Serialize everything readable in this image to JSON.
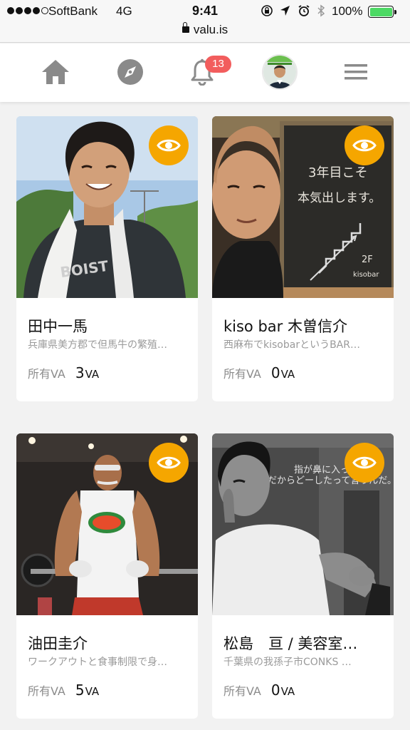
{
  "status_bar": {
    "carrier": "SoftBank",
    "network": "4G",
    "time": "9:41",
    "battery": "100%",
    "battery_level": 1.0,
    "signal_bars_filled": 4,
    "signal_bars_total": 5,
    "icons": [
      "rotation-lock-icon",
      "location-arrow-icon",
      "alarm-icon",
      "bluetooth-icon"
    ]
  },
  "url_bar": {
    "domain": "valu.is",
    "secure": true
  },
  "nav": {
    "items": [
      "home-icon",
      "compass-icon",
      "bell-icon",
      "avatar",
      "menu-icon"
    ],
    "notification_count": "13"
  },
  "colors": {
    "accent": "#f5a600",
    "badge": "#f25d5d",
    "background": "#f2f2f2",
    "battery": "#4cd964"
  },
  "cards": [
    {
      "name": "田中一馬",
      "description": "兵庫県美方郡で但馬牛の繁殖…",
      "stat_label": "所有VA",
      "stat_value": "3",
      "stat_unit": "VA"
    },
    {
      "name": "kiso bar 木曽信介",
      "description": "西麻布でkisobarというBAR…",
      "stat_label": "所有VA",
      "stat_value": "0",
      "stat_unit": "VA",
      "photo_text": [
        "3年目こそ",
        "本気出します。",
        "2F",
        "kisobar"
      ]
    },
    {
      "name": "油田圭介",
      "description": "ワークアウトと食事制限で身…",
      "stat_label": "所有VA",
      "stat_value": "5",
      "stat_unit": "VA"
    },
    {
      "name": "松島　亘 / 美容室…",
      "description": "千葉県の我孫子市CONKS …",
      "stat_label": "所有VA",
      "stat_value": "0",
      "stat_unit": "VA",
      "photo_text": [
        "指が鼻に入ってるっ",
        "だからどーしたって言うんだ。"
      ]
    }
  ]
}
